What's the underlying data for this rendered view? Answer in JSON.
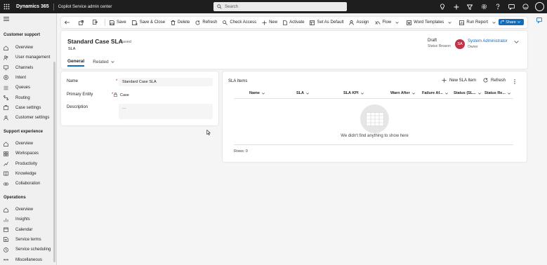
{
  "topbar": {
    "app_name": "Dynamics 365",
    "area_name": "Copilot Service admin center",
    "search_placeholder": "Search",
    "user_initials": "SV"
  },
  "sidebar": {
    "sections": [
      {
        "title": "Customer support",
        "items": [
          {
            "label": "Overview",
            "icon": "home-icon"
          },
          {
            "label": "User management",
            "icon": "people-icon"
          },
          {
            "label": "Channels",
            "icon": "channels-icon"
          },
          {
            "label": "Intent",
            "icon": "intent-icon"
          },
          {
            "label": "Queues",
            "icon": "queues-icon"
          },
          {
            "label": "Routing",
            "icon": "routing-icon"
          },
          {
            "label": "Case settings",
            "icon": "case-settings-icon"
          },
          {
            "label": "Customer settings",
            "icon": "customer-settings-icon"
          }
        ]
      },
      {
        "title": "Support experience",
        "items": [
          {
            "label": "Overview",
            "icon": "home-icon"
          },
          {
            "label": "Workspaces",
            "icon": "workspaces-icon"
          },
          {
            "label": "Productivity",
            "icon": "productivity-icon"
          },
          {
            "label": "Knowledge",
            "icon": "knowledge-icon"
          },
          {
            "label": "Collaboration",
            "icon": "collaboration-icon"
          }
        ]
      },
      {
        "title": "Operations",
        "items": [
          {
            "label": "Overview",
            "icon": "home-icon"
          },
          {
            "label": "Insights",
            "icon": "insights-icon"
          },
          {
            "label": "Calendar",
            "icon": "calendar-icon"
          },
          {
            "label": "Service terms",
            "icon": "service-terms-icon"
          },
          {
            "label": "Service scheduling",
            "icon": "scheduling-icon"
          },
          {
            "label": "Miscellaneous",
            "icon": "misc-icon"
          }
        ]
      }
    ]
  },
  "commandbar": {
    "save": "Save",
    "save_close": "Save & Close",
    "delete": "Delete",
    "refresh": "Refresh",
    "check_access": "Check Access",
    "new": "New",
    "activate": "Activate",
    "set_default": "Set As Default",
    "assign": "Assign",
    "flow": "Flow",
    "word_templates": "Word Templates",
    "run_report": "Run Report",
    "share": "Share"
  },
  "record": {
    "title": "Standard Case SLA",
    "saved_status": "- Saved",
    "entity": "SLA",
    "status_reason_value": "Draft",
    "status_reason_label": "Status Reason",
    "owner_initials": "SA",
    "owner_name": "System Administrator",
    "owner_label": "Owner",
    "tabs": [
      {
        "label": "General",
        "active": true
      },
      {
        "label": "Related",
        "active": false
      }
    ]
  },
  "form": {
    "name_label": "Name",
    "name_value": "Standard Case SLA",
    "primary_entity_label": "Primary Entity",
    "primary_entity_value": "Case",
    "description_label": "Description",
    "description_value": "---",
    "required_marker": "*"
  },
  "sla_items": {
    "title": "SLA Items",
    "new_button": "New SLA Item",
    "refresh_button": "Refresh",
    "columns": [
      "Name",
      "SLA",
      "SLA KPI",
      "Warn After",
      "Failure Af...",
      "Status (SL...",
      "Status Re..."
    ],
    "empty_message": "We didn't find anything to show here",
    "rows_label": "Rows: 0"
  },
  "colors": {
    "accent": "#0f6cbd",
    "topbar": "#1e1e1e",
    "owner_avatar": "#c4314b",
    "required": "#a4262c"
  }
}
